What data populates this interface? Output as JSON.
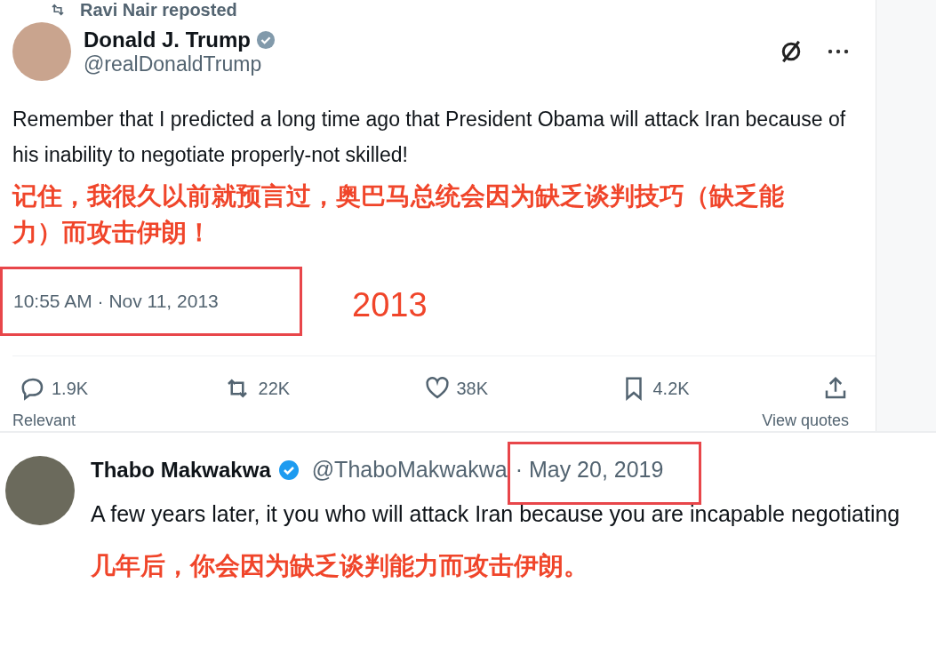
{
  "repost_banner": {
    "text": "Ravi Nair reposted"
  },
  "post": {
    "author": {
      "name": "Donald J. Trump",
      "handle": "@realDonaldTrump",
      "verified": true
    },
    "text": "Remember that I predicted a long time ago that President Obama will attack Iran because of his inability to negotiate properly-not skilled!",
    "translation": "记住，我很久以前就预言过，奥巴马总统会因为缺乏谈判技巧（缺乏能力）而攻击伊朗！",
    "timestamp": "10:55 AM · Nov 11, 2013",
    "annotation_year": "2013",
    "actions": [
      {
        "kind": "reply",
        "count": "1.9K"
      },
      {
        "kind": "repost",
        "count": "22K"
      },
      {
        "kind": "like",
        "count": "38K"
      },
      {
        "kind": "bookmark",
        "count": "4.2K"
      },
      {
        "kind": "share"
      }
    ],
    "sort_label": "Relevant",
    "quotes_link": "View quotes"
  },
  "reply": {
    "author": {
      "name": "Thabo Makwakwa",
      "handle": "@ThaboMakwakwa",
      "verified": true
    },
    "date": "· May 20, 2019",
    "text": "A few years later, it you who will attack Iran because you are incapable negotiating",
    "translation": "几年后，你会因为缺乏谈判能力而攻击伊朗。"
  }
}
